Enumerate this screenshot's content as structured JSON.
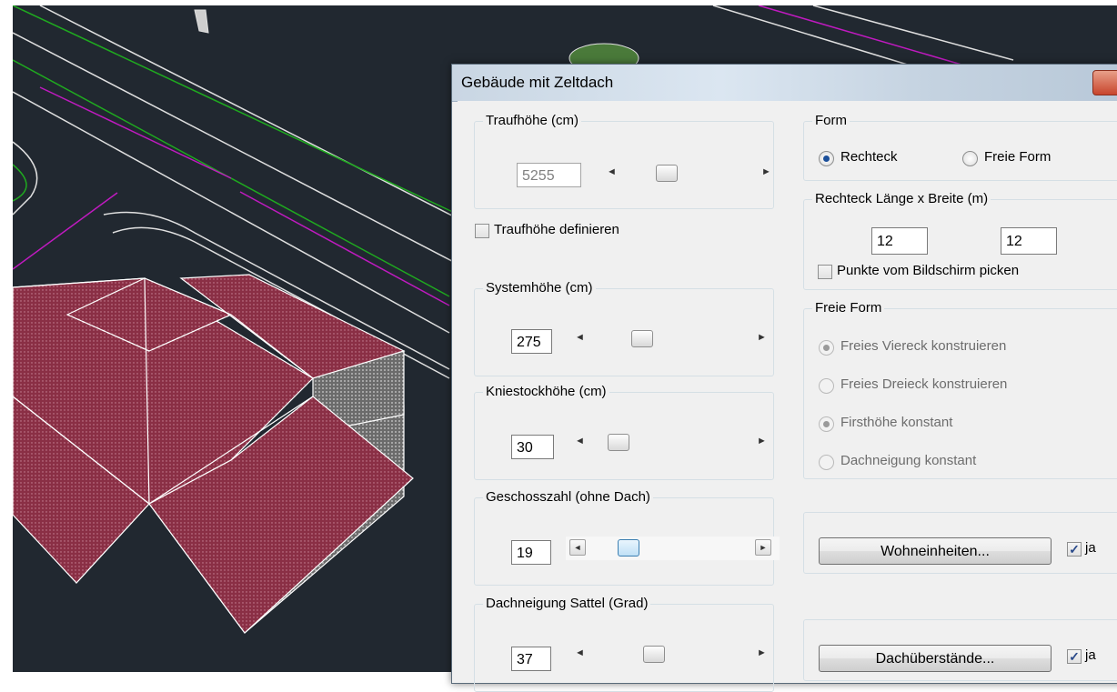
{
  "dialog": {
    "title": "Gebäude mit Zeltdach"
  },
  "traufhoehe": {
    "label": "Traufhöhe (cm)",
    "value": "5255",
    "define_label": "Traufhöhe definieren",
    "define_checked": false,
    "enabled": false
  },
  "systemhoehe": {
    "label": "Systemhöhe (cm)",
    "value": "275"
  },
  "kniestockhoehe": {
    "label": "Kniestockhöhe (cm)",
    "value": "30"
  },
  "geschosszahl": {
    "label": "Geschosszahl (ohne Dach)",
    "value": "19"
  },
  "dachneigung": {
    "label": "Dachneigung Sattel (Grad)",
    "value": "37"
  },
  "form": {
    "label": "Form",
    "options": [
      "Rechteck",
      "Freie Form"
    ],
    "selected": "Rechteck"
  },
  "rechteck": {
    "label": "Rechteck Länge x Breite (m)",
    "laenge": "12",
    "breite": "12",
    "pick_label": "Punkte vom Bildschirm picken",
    "pick_checked": false
  },
  "freie_form": {
    "label": "Freie Form",
    "options": [
      "Freies Viereck konstruieren",
      "Freies Dreieck konstruieren",
      "Firsthöhe konstant",
      "Dachneigung konstant"
    ],
    "enabled": false
  },
  "wohneinheiten": {
    "button_label": "Wohneinheiten...",
    "checkbox_label": "ja",
    "checked": true
  },
  "dachueberstaende": {
    "button_label": "Dachüberstände...",
    "checkbox_label": "ja",
    "checked": true
  },
  "colors": {
    "cad_background": "#212830",
    "roof_fill": "#8a2f45",
    "road_green": "#1faa1f",
    "road_magenta": "#c01ac0",
    "dialog_background": "#f0f0f0"
  }
}
